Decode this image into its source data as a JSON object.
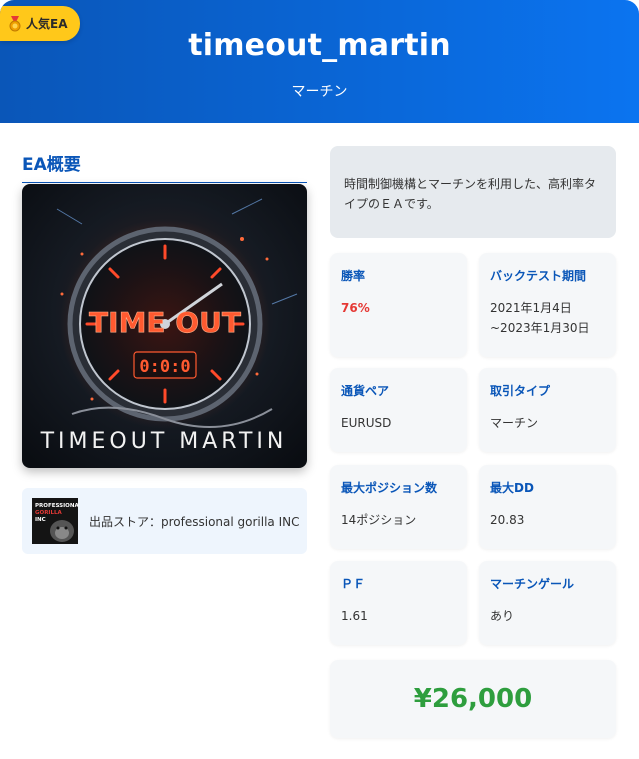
{
  "badge": {
    "label": "人気EA",
    "icon": "medal-icon"
  },
  "header": {
    "title": "timeout_martin",
    "subtitle": "マーチン"
  },
  "overview": {
    "section_title": "EA概要",
    "image_caption": "TIMEOUT  MARTIN",
    "image_clock_text": "TIME OUT",
    "image_digits": "0:0:0"
  },
  "store": {
    "label": "出品ストア：professional gorilla INC",
    "logo_text": "PROFESSIONAL GORILLA INC"
  },
  "description": "時間制御機構とマーチンを利用した、高利率タイプのＥＡです。",
  "stats": [
    {
      "label": "勝率",
      "value": "76%"
    },
    {
      "label": "バックテスト期間",
      "value": "2021年1月4日~2023年1月30日"
    },
    {
      "label": "通貨ペア",
      "value": "EURUSD"
    },
    {
      "label": "取引タイプ",
      "value": "マーチン"
    },
    {
      "label": "最大ポジション数",
      "value": "14ポジション"
    },
    {
      "label": "最大DD",
      "value": "20.83"
    },
    {
      "label": "ＰＦ",
      "value": "1.61"
    },
    {
      "label": "マーチンゲール",
      "value": "あり"
    }
  ],
  "price": "¥26,000",
  "colors": {
    "header": "#0a66d6",
    "badge": "#ffc81a",
    "accent": "#0a56b8",
    "win_rate": "#e53935",
    "price": "#2e9e3e"
  }
}
